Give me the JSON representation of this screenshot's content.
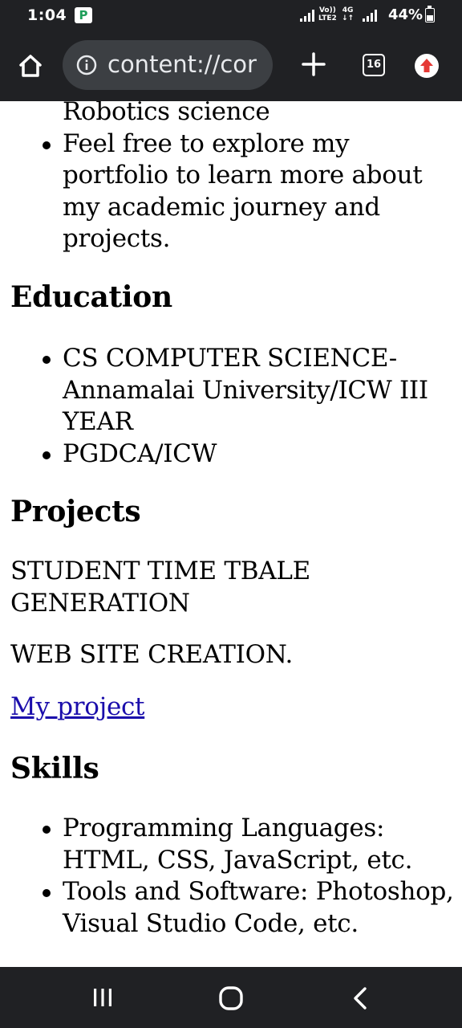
{
  "status_bar": {
    "time": "1:04",
    "app_icon_glyph": "P",
    "volte_top": "Vo))",
    "volte_bottom": "LTE2",
    "network_top": "4G",
    "network_bottom": "↓↑",
    "battery_percent": "44%",
    "battery_level": 0.44
  },
  "browser": {
    "url": "content://cor",
    "tab_count": "16",
    "icons": {
      "home": "home-icon",
      "info": "info-icon",
      "new_tab": "plus-icon",
      "update": "update-arrow-icon"
    },
    "update_color": "#e53935"
  },
  "page": {
    "intro_items": [
      "Robotics science",
      "Feel free to explore my portfolio to learn more about my academic journey and projects."
    ],
    "education": {
      "heading": "Education",
      "items": [
        "CS COMPUTER SCIENCE-Annamalai University/ICW III YEAR",
        "PGDCA/ICW"
      ]
    },
    "projects": {
      "heading": "Projects",
      "items": [
        "STUDENT TIME TBALE GENERATION",
        "WEB SITE CREATION."
      ],
      "link_text": "My project",
      "link_color": "#1a0dab"
    },
    "skills": {
      "heading": "Skills",
      "items": [
        "Programming Languages: HTML, CSS, JavaScript, etc.",
        "Tools and Software: Photoshop, Visual Studio Code, etc."
      ]
    }
  },
  "nav_bar": {
    "recents": "recents-icon",
    "home": "home-circle-icon",
    "back": "back-chevron-icon"
  }
}
